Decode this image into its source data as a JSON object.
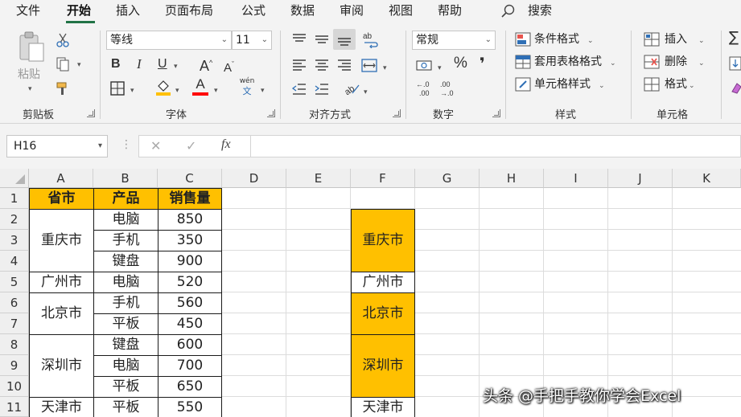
{
  "menu": {
    "tabs": [
      "文件",
      "开始",
      "插入",
      "页面布局",
      "公式",
      "数据",
      "审阅",
      "视图",
      "帮助"
    ],
    "active_tab": "开始",
    "search_label": "搜索"
  },
  "ribbon": {
    "clipboard": {
      "paste_label": "粘贴",
      "group_label": "剪贴板"
    },
    "font": {
      "font_name": "等线",
      "font_size": "11",
      "bold": "B",
      "italic": "I",
      "underline": "U",
      "grow": "A",
      "shrink": "A",
      "phonetic_top": "wén",
      "phonetic_bottom": "文",
      "font_color_glyph": "A",
      "group_label": "字体",
      "colors": {
        "fill": "#ffc000",
        "font": "#ff0000"
      }
    },
    "alignment": {
      "group_label": "对齐方式"
    },
    "number": {
      "format": "常规",
      "percent": "%",
      "comma": "❜",
      "group_label": "数字"
    },
    "styles": {
      "conditional": "条件格式",
      "table": "套用表格格式",
      "cell_styles": "单元格样式",
      "group_label": "样式"
    },
    "cells": {
      "insert": "插入",
      "delete": "删除",
      "format": "格式",
      "group_label": "单元格"
    }
  },
  "formula_bar": {
    "name_box": "H16",
    "formula": "",
    "fx": "fx",
    "cancel": "✕",
    "enter": "✓"
  },
  "sheet": {
    "columns": [
      "A",
      "B",
      "C",
      "D",
      "E",
      "F",
      "G",
      "H",
      "I",
      "J",
      "K"
    ],
    "rows": [
      "1",
      "2",
      "3",
      "4",
      "5",
      "6",
      "7",
      "8",
      "9",
      "10",
      "11"
    ],
    "header": {
      "a": "省市",
      "b": "产品",
      "c": "销售量"
    },
    "provinces": [
      {
        "name": "重庆市"
      },
      {
        "name": "广州市"
      },
      {
        "name": "北京市"
      },
      {
        "name": "深圳市"
      },
      {
        "name": "天津市"
      }
    ],
    "products": [
      "电脑",
      "手机",
      "键盘",
      "电脑",
      "手机",
      "平板",
      "键盘",
      "电脑",
      "平板",
      "平板"
    ],
    "sales": [
      "850",
      "350",
      "900",
      "520",
      "560",
      "450",
      "600",
      "700",
      "650",
      "550"
    ],
    "column_f": [
      "重庆市",
      "广州市",
      "北京市",
      "深圳市",
      "天津市"
    ],
    "highlight_color": "#ffc000"
  },
  "watermark": "头条 @手把手教你学会Excel"
}
